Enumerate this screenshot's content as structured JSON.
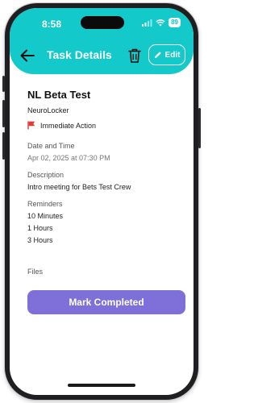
{
  "status_bar": {
    "time": "8:58",
    "battery": "89",
    "icons": [
      "signal-icon",
      "wifi-icon",
      "battery-icon"
    ]
  },
  "header": {
    "title": "Task Details",
    "edit_label": "Edit",
    "icons": [
      "back-arrow-icon",
      "trash-icon",
      "pencil-icon"
    ],
    "background_color": "#13c9c9"
  },
  "task": {
    "title": "NL Beta Test",
    "project": "NeuroLocker",
    "priority": "Immediate Action",
    "priority_color": "#e53935",
    "date_label": "Date and Time",
    "date_value": "Apr 02, 2025 at 07:30 PM",
    "description_label": "Description",
    "description_value": "Intro meeting for Bets Test Crew",
    "reminders_label": "Reminders",
    "reminders": [
      "10 Minutes",
      "1 Hours",
      "3 Hours"
    ],
    "files_label": "Files"
  },
  "actions": {
    "mark_completed": "Mark Completed",
    "button_color": "#7f6fd9"
  }
}
